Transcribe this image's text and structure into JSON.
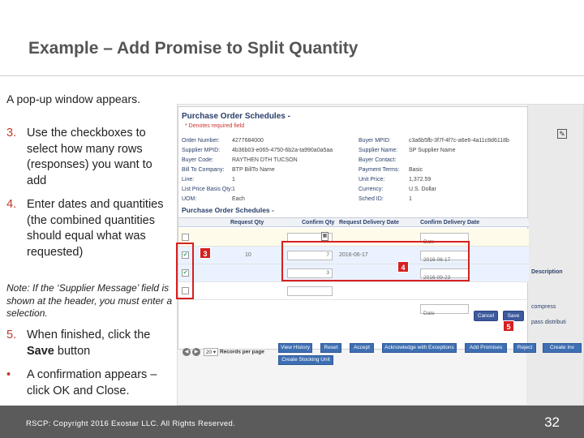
{
  "slide": {
    "title": "Example – Add Promise to Split Quantity",
    "intro": "A pop-up window appears.",
    "items": [
      {
        "num": "3.",
        "text": "Use the checkboxes to select how many rows (responses) you want to add"
      },
      {
        "num": "4.",
        "text": "Enter dates and quantities (the combined quantities should equal what was requested)"
      },
      {
        "num": "5.",
        "text_pre": "When finished, click the ",
        "text_bold": "Save",
        "text_post": " button"
      },
      {
        "num": "•",
        "text": "A confirmation appears – click OK and Close."
      }
    ],
    "note": "Note: If the ‘Supplier Message’ field is shown at the header, you must enter a selection.",
    "footer": "RSCP: Copyright 2016 Exostar LLC. All Rights Reserved.",
    "page_number": "32"
  },
  "popup": {
    "title": "Purchase Order Schedules -",
    "required": "* Denotes required field",
    "left_fields": [
      {
        "k": "Order Number:",
        "v": "4277684000"
      },
      {
        "k": "Supplier MPID:",
        "v": "4b36b03-e065-4750-6b2a-ta990a0a5aa"
      },
      {
        "k": "Buyer Code:",
        "v": "RAYTHEN DTH TUCSON"
      },
      {
        "k": "Bill To Company:",
        "v": "BTP BillTo Name"
      },
      {
        "k": "Line:",
        "v": "1"
      },
      {
        "k": "List Price Basis Qty:",
        "v": "1"
      },
      {
        "k": "UOM:",
        "v": "Each"
      }
    ],
    "right_fields": [
      {
        "k": "Buyer MPID:",
        "v": "c3a6b5fb-3f7f-4f7c-a6e6-4a11c8d6118b"
      },
      {
        "k": "Supplier Name:",
        "v": "SP Supplier Name"
      },
      {
        "k": "Buyer Contact:",
        "v": ""
      },
      {
        "k": "Payment Terms:",
        "v": "Basic"
      },
      {
        "k": "Unit Price:",
        "v": "1,372.59"
      },
      {
        "k": "Currency:",
        "v": "U.S. Dollar"
      },
      {
        "k": "Sched ID:",
        "v": "1"
      }
    ],
    "section_title": "Purchase Order Schedules -",
    "columns": [
      "Request Qty",
      "Confirm Qty",
      "Request Delivery Date",
      "Confirm Delivery Date"
    ],
    "rows": [
      {
        "checked": false,
        "req_qty": "",
        "confirm_qty": "",
        "req_date": "",
        "confirm_date": "Date"
      },
      {
        "checked": true,
        "req_qty": "10",
        "confirm_qty": "7",
        "req_date": "2016-06-17",
        "confirm_date": "2016-06-17"
      },
      {
        "checked": true,
        "req_qty": "",
        "confirm_qty": "3",
        "req_date": "",
        "confirm_date": "2016-09-23"
      },
      {
        "checked": false,
        "req_qty": "",
        "confirm_qty": "",
        "req_date": "",
        "confirm_date": "Date"
      }
    ],
    "cancel": "Cancel",
    "save": "Save",
    "check_glyph": "✔"
  },
  "toolbar": {
    "buttons": [
      "View History",
      "Reset",
      "Accept",
      "Acknowledge with Exceptions",
      "Add Promises",
      "Reject",
      "Create Inv"
    ],
    "create_stocking_unit": "Create Stocking Unit",
    "per_page_value": "20",
    "per_page_label": "Records per page"
  },
  "background_right": {
    "description": "Description",
    "compress": "compress",
    "distrib": "pass distributi"
  },
  "callouts": {
    "three": "3",
    "four": "4",
    "five": "5"
  },
  "colors": {
    "callout_red": "#d62020",
    "footer_gray": "#5b5b5b",
    "button_blue": "#3d5a9e"
  }
}
